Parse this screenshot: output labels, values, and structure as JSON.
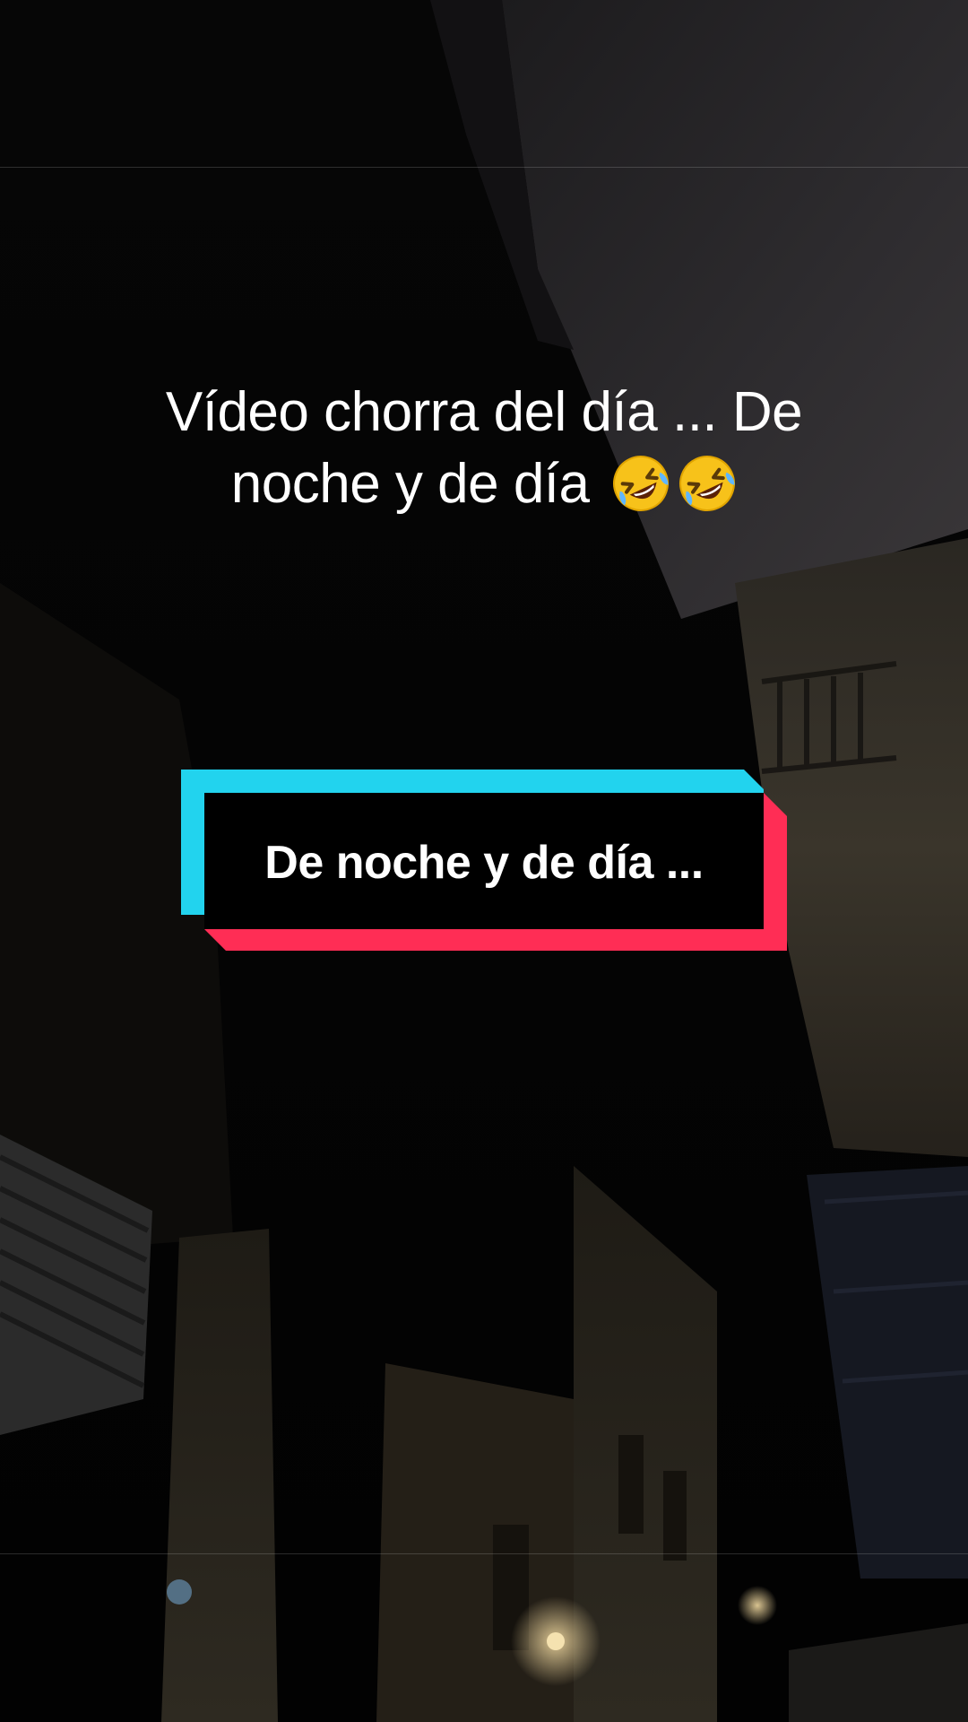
{
  "caption": {
    "line1": "Vídeo chorra del día ... De",
    "line2": "noche y de día"
  },
  "sticker": {
    "text": "De noche y de día ...",
    "accent_cyan": "#22d3ee",
    "accent_red": "#ff2d55",
    "fill": "#000000"
  },
  "emojis": [
    "rolling-on-floor-laughing-icon",
    "rolling-on-floor-laughing-icon"
  ]
}
